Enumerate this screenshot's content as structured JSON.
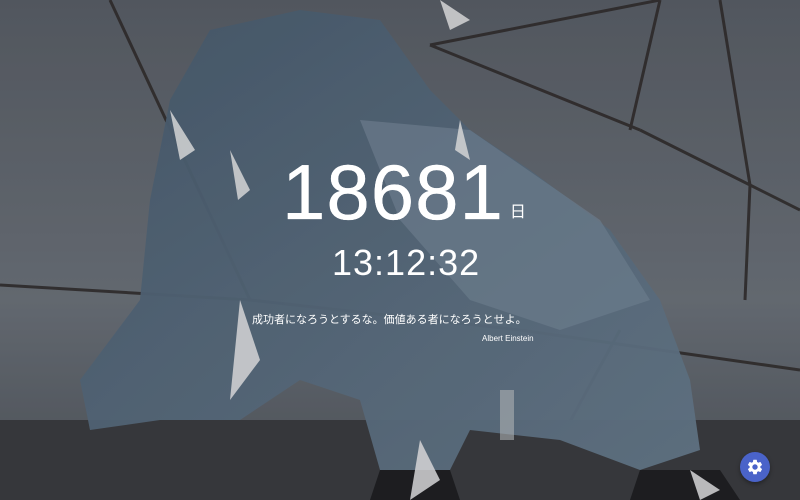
{
  "screen": {
    "days_count": "18681",
    "days_unit": "日",
    "clock_time": "13:12:32",
    "quote_text": "成功者になろうとするな。価値ある者になろうとせよ。",
    "quote_author": "Albert Einstein"
  },
  "controls": {
    "settings_icon": "gear-icon",
    "accent_color": "#4a63c9"
  }
}
